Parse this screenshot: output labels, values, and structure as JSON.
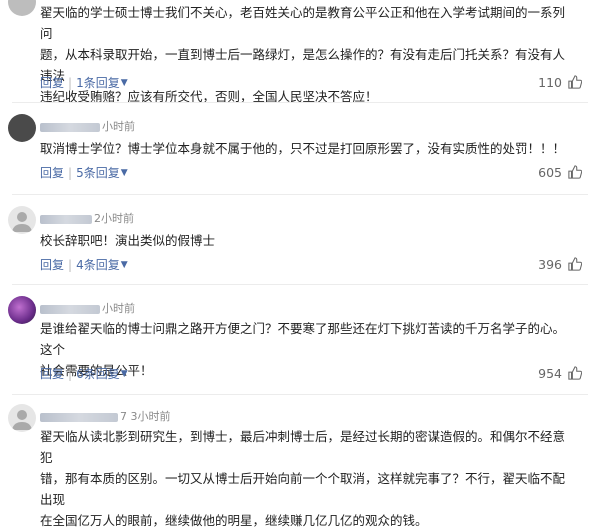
{
  "comments": [
    {
      "user_suffix": "",
      "time": "",
      "lines": [
        "翟天临的学士硕士博士我们不关心，老百姓关心的是教育公平公正和他在入学考试期间的一系列问",
        "题，从本科录取开始，一直到博士后一路绿灯，是怎么操作的？有没有走后门托关系？有没有人违法",
        "违纪收受贿赂？应该有所交代，否则，全国人民坚决不答应！"
      ],
      "reply_label": "回复",
      "replies_count": "1条回复",
      "likes": "110"
    },
    {
      "user_suffix": "",
      "time": "小时前",
      "lines": [
        "取消博士学位？博士学位本身就不属于他的，只不过是打回原形罢了，没有实质性的处罚！！！"
      ],
      "reply_label": "回复",
      "replies_count": "5条回复",
      "likes": "605"
    },
    {
      "user_suffix": "2",
      "time": "小时前",
      "lines": [
        "校长辞职吧！演出类似的假博士"
      ],
      "reply_label": "回复",
      "replies_count": "4条回复",
      "likes": "396"
    },
    {
      "user_suffix": "",
      "time": "小时前",
      "lines": [
        "是谁给翟天临的博士问鼎之路开方便之门？不要寒了那些还在灯下挑灯苦读的千万名学子的心。这个",
        "社会需要的是公平！"
      ],
      "reply_label": "回复",
      "replies_count": "6条回复",
      "likes": "954"
    },
    {
      "user_suffix": "7",
      "time": "3小时前",
      "lines": [
        "翟天临从读北影到研究生，到博士，最后冲刺博士后，是经过长期的密谋造假的。和偶尔不经意犯",
        "错，那有本质的区别。一切又从博士后开始向前一个个取消，这样就完事了？不行，翟天临不配出现",
        "在全国亿万人的眼前，继续做他的明星，继续赚几亿几亿的观众的钱。"
      ],
      "reply_label": "",
      "replies_count": "",
      "likes": ""
    }
  ],
  "icons": {
    "reply_sep": "|",
    "arrow": "chevron-down-icon",
    "like": "thumbs-up-icon"
  }
}
